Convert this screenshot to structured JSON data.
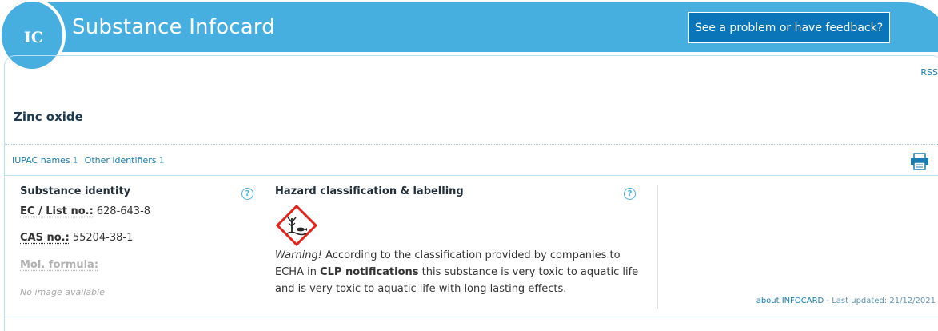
{
  "header": {
    "badge": "IC",
    "title": "Substance Infocard",
    "feedback_button": "See a problem or have feedback?"
  },
  "rss_link": "RSS",
  "substance": {
    "name": "Zinc oxide"
  },
  "tabs": [
    {
      "label": "IUPAC names",
      "count": "1"
    },
    {
      "label": "Other identifiers",
      "count": "1"
    }
  ],
  "identity": {
    "title": "Substance identity",
    "help": "?",
    "ec_label": "EC / List no.:",
    "ec_value": "628-643-8",
    "cas_label": "CAS no.:",
    "cas_value": "55204-38-1",
    "formula_label": "Mol. formula:",
    "no_image": "No image available"
  },
  "hazard": {
    "title": "Hazard classification & labelling",
    "help": "?",
    "pictogram": "environment-hazard-icon",
    "warning": "Warning!",
    "text_before": " According to the classification provided by companies to ECHA in ",
    "clp": "CLP notifications",
    "text_after": " this substance is very toxic to aquatic life and is very toxic to aquatic life with long lasting effects."
  },
  "footer": {
    "about_link": "about INFOCARD",
    "last_updated": " - Last updated: 21/12/2021"
  },
  "colors": {
    "header_blue": "#47aee0",
    "button_blue": "#0a76b9",
    "link_blue": "#1a7cb0",
    "hazard_red": "#e2231a"
  }
}
